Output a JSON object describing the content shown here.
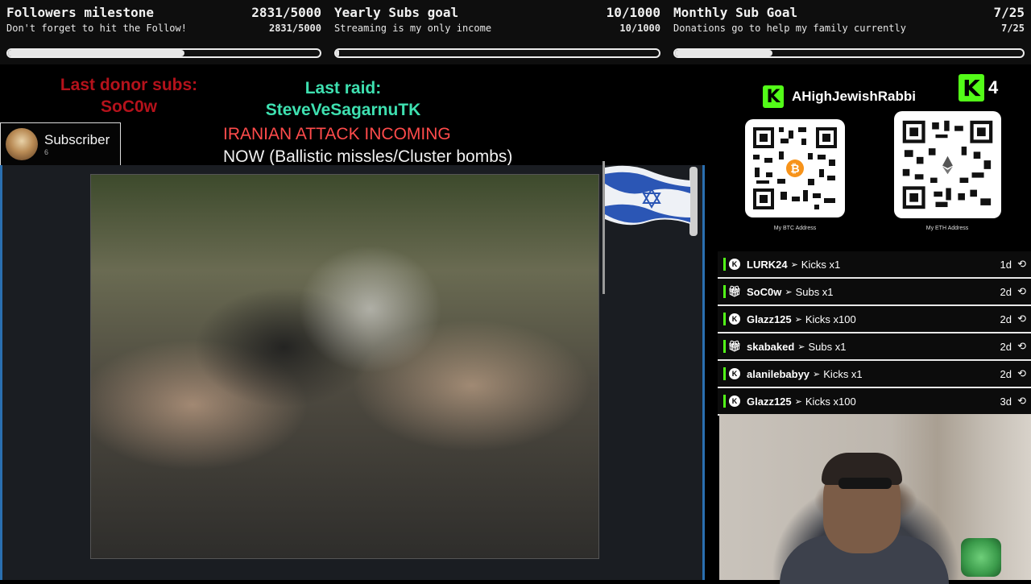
{
  "goals": [
    {
      "title": "Followers milestone",
      "count": "2831/5000",
      "subtitle": "Don't forget to hit the Follow!",
      "subcount": "2831/5000",
      "progress": 0.566
    },
    {
      "title": "Yearly Subs goal",
      "count": "10/1000",
      "subtitle": "Streaming is my only income",
      "subcount": "10/1000",
      "progress": 0.01
    },
    {
      "title": "Monthly Sub Goal",
      "count": "7/25",
      "subtitle": "Donations go to help my family currently",
      "subcount": "7/25",
      "progress": 0.28
    }
  ],
  "overlay": {
    "donor_label": "Last donor subs:",
    "donor_name": "SoC0w",
    "raid_label": "Last raid:",
    "raid_name": "SteveVeSagarnuTK",
    "attack_line1": "IRANIAN ATTACK INCOMING",
    "attack_line2": "NOW (Ballistic missles/Cluster bombs)"
  },
  "subscriber_box": {
    "label": "Subscriber",
    "count": "6"
  },
  "channel": {
    "name": "AHighJewishRabbi",
    "kick_count": "4",
    "kick_logo": "K"
  },
  "donations": {
    "btc_caption": "My BTC Address",
    "eth_caption": "My ETH Address"
  },
  "events": [
    {
      "icon": "kick-icon",
      "name": "LURK24",
      "kind": "Kicks x1",
      "time": "1d"
    },
    {
      "icon": "gift-icon",
      "name": "SoC0w",
      "kind": "Subs x1",
      "time": "2d"
    },
    {
      "icon": "kick-icon",
      "name": "Glazz125",
      "kind": "Kicks x100",
      "time": "2d"
    },
    {
      "icon": "gift-icon",
      "name": "skabaked",
      "kind": "Subs x1",
      "time": "2d"
    },
    {
      "icon": "kick-icon",
      "name": "alanilebabyy",
      "kind": "Kicks x1",
      "time": "2d"
    },
    {
      "icon": "kick-icon",
      "name": "Glazz125",
      "kind": "Kicks x100",
      "time": "3d"
    }
  ],
  "colors": {
    "kick_green": "#53fc18",
    "donor_red": "#b5121b",
    "raid_teal": "#3ee0b0",
    "attack_red": "#ff4b4b"
  }
}
